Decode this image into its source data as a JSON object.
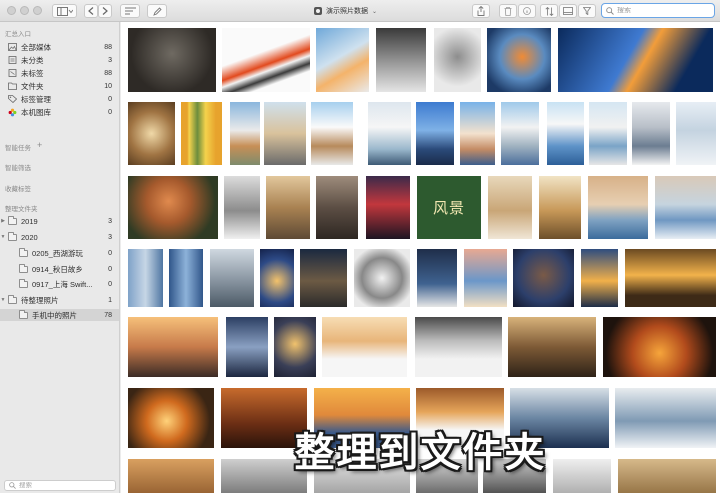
{
  "window": {
    "title": "演示照片数据"
  },
  "toolbar": {
    "search_placeholder": "搜索"
  },
  "sidebar": {
    "library_title": "汇总入口",
    "library_items": [
      {
        "label": "全部媒体",
        "count": "88",
        "icon": "photos-icon"
      },
      {
        "label": "未分类",
        "count": "3",
        "icon": "uncategorized-icon"
      },
      {
        "label": "未标签",
        "count": "88",
        "icon": "untagged-icon"
      },
      {
        "label": "文件夹",
        "count": "10",
        "icon": "folder-icon"
      },
      {
        "label": "标签管理",
        "count": "0",
        "icon": "tag-icon"
      },
      {
        "label": "本机图库",
        "count": "0",
        "icon": "photos-app-icon"
      }
    ],
    "smart_tasks_title": "智能任务",
    "smart_filter_title": "智能筛选",
    "favorite_tags_title": "收藏标签",
    "folders_title": "整理文件夹",
    "folders": [
      {
        "label": "2019",
        "count": "3",
        "level": 0,
        "expanded": false
      },
      {
        "label": "2020",
        "count": "3",
        "level": 0,
        "expanded": true
      },
      {
        "label": "0205_西湖游玩",
        "count": "0",
        "level": 1,
        "expanded": false
      },
      {
        "label": "0914_秋日故乡",
        "count": "0",
        "level": 1,
        "expanded": false
      },
      {
        "label": "0917_上海 Swift...",
        "count": "0",
        "level": 1,
        "expanded": false
      },
      {
        "label": "待整理照片",
        "count": "1",
        "level": 0,
        "expanded": true
      },
      {
        "label": "手机中的照片",
        "count": "78",
        "level": 1,
        "expanded": false
      }
    ],
    "search_placeholder": "搜索"
  },
  "photo_caption": "风景",
  "overlay_text": "整理到文件夹",
  "colors": {
    "accent": "#6aa5e6",
    "sidebar_bg": "#e9e9e9",
    "selected_row": "#d4d4d4"
  }
}
